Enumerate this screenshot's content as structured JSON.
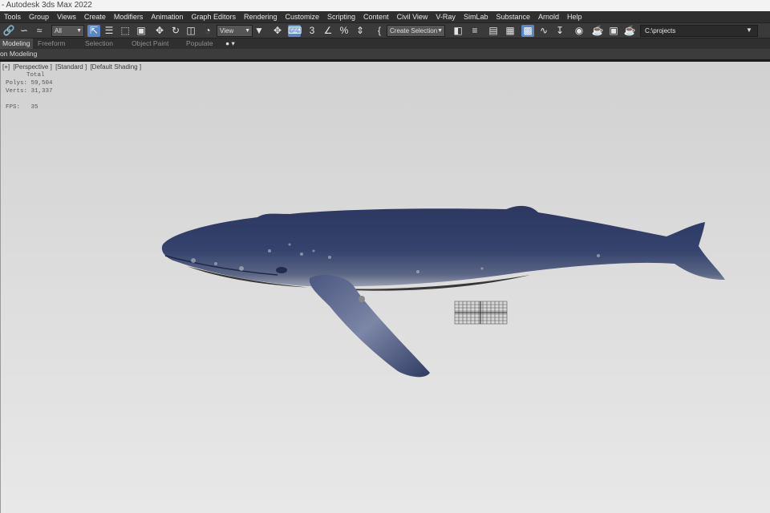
{
  "window": {
    "title": "- Autodesk 3ds Max 2022"
  },
  "menubar": {
    "items": [
      "Tools",
      "Group",
      "Views",
      "Create",
      "Modifiers",
      "Animation",
      "Graph Editors",
      "Rendering",
      "Customize",
      "Scripting",
      "Content",
      "Civil View",
      "V-Ray",
      "SimLab",
      "Substance",
      "Arnold",
      "Help"
    ]
  },
  "toolbar": {
    "selection_filter": "All",
    "reference_coord": "View",
    "named_selection_set": "Create Selection Set",
    "project_path": "C:\\projects",
    "icons": [
      "link-icon",
      "unlink-icon",
      "bind-spacewarp-icon",
      "select-object-icon",
      "select-by-name-icon",
      "rect-selection-icon",
      "window-crossing-icon",
      "move-icon",
      "rotate-icon",
      "scale-icon",
      "placement-icon",
      "use-pivot-icon",
      "select-manipulate-icon",
      "keyboard-shortcut-icon",
      "snaps-toggle-icon",
      "angle-snap-icon",
      "percent-snap-icon",
      "spinner-snap-icon",
      "edit-named-sets-icon",
      "mirror-icon",
      "align-icon",
      "scene-explorer-icon",
      "layer-explorer-icon",
      "toggle-ribbon-icon",
      "curve-editor-icon",
      "schematic-view-icon",
      "material-editor-icon",
      "render-setup-icon",
      "rendered-frame-icon",
      "render-production-icon"
    ]
  },
  "ribbon": {
    "tabs": [
      "Modeling",
      "Freeform",
      "Selection",
      "Object Paint",
      "Populate"
    ],
    "active_tab": "Modeling",
    "panel_label": "on Modeling"
  },
  "viewport": {
    "label_plus": "[+]",
    "label_view": "[Perspective ]",
    "label_shader": "[Standard ]",
    "label_shading": "[Default Shading ]",
    "stats": {
      "header": "Total",
      "polys_label": "Polys:",
      "polys_value": "59,504",
      "verts_label": "Verts:",
      "verts_value": "31,337",
      "fps_label": "FPS:",
      "fps_value": "35"
    },
    "model_color": "#2f3b63",
    "grid_color": "#555555"
  }
}
